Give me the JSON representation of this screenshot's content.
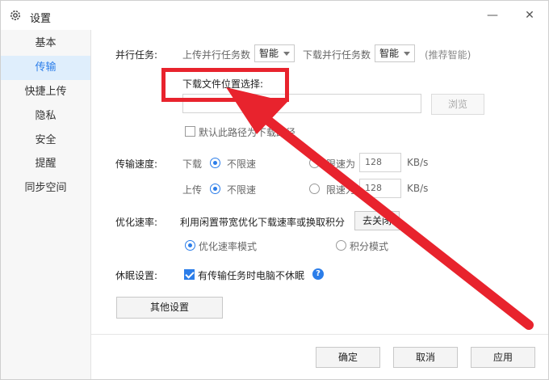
{
  "window": {
    "title": "设置",
    "icon": "gear-icon",
    "controls": {
      "minimize": "—",
      "close": "✕"
    }
  },
  "sidebar": {
    "items": [
      {
        "label": "基本",
        "active": false
      },
      {
        "label": "传输",
        "active": true
      },
      {
        "label": "快捷上传",
        "active": false
      },
      {
        "label": "隐私",
        "active": false
      },
      {
        "label": "安全",
        "active": false
      },
      {
        "label": "提醒",
        "active": false
      },
      {
        "label": "同步空间",
        "active": false
      }
    ]
  },
  "parallel": {
    "label": "并行任务:",
    "upload_label": "上传并行任务数",
    "upload_value": "智能",
    "download_label": "下载并行任务数",
    "download_value": "智能",
    "hint": "(推荐智能)"
  },
  "download_location": {
    "label": "下载文件位置选择:",
    "path_value": "",
    "browse_label": "浏览",
    "default_checkbox_label": "默认此路径为下载路径",
    "default_checked": false
  },
  "speed": {
    "label": "传输速度:",
    "download": {
      "label": "下载",
      "unlimited_label": "不限速",
      "limit_label": "限速为",
      "value": "128",
      "unit": "KB/s",
      "mode": "unlimited"
    },
    "upload": {
      "label": "上传",
      "unlimited_label": "不限速",
      "limit_label": "限速为",
      "value": "128",
      "unit": "KB/s",
      "mode": "unlimited"
    }
  },
  "optimize": {
    "label": "优化速率:",
    "description": "利用闲置带宽优化下载速率或换取积分",
    "button_label": "去关闭",
    "option_speed": "优化速率模式",
    "option_points": "积分模式",
    "selected": "speed"
  },
  "sleep": {
    "label": "休眠设置:",
    "checkbox_label": "有传输任务时电脑不休眠",
    "checked": true,
    "help_icon": "question-icon"
  },
  "other_settings_label": "其他设置",
  "footer": {
    "ok_label": "确定",
    "cancel_label": "取消",
    "apply_label": "应用"
  },
  "annotation_colors": {
    "highlight": "#e8232d"
  }
}
